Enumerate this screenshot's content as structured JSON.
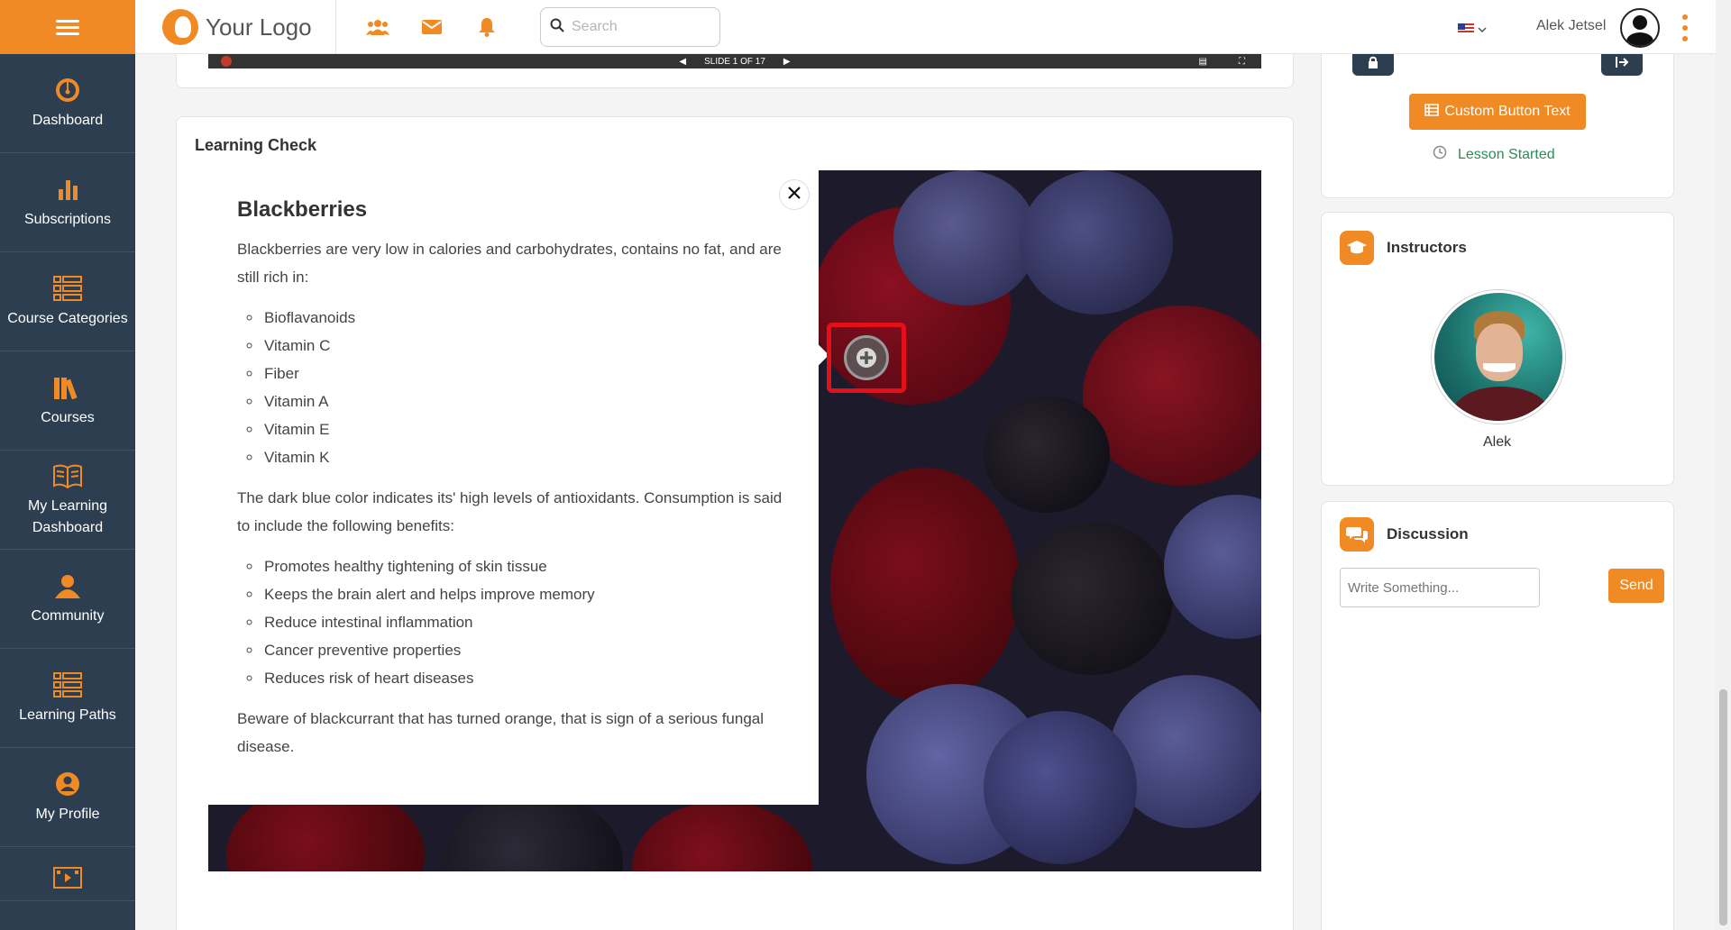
{
  "header": {
    "logo_text": "Your Logo",
    "search_placeholder": "Search",
    "user_name": "Alek Jetsel",
    "language_flag": "us-flag-icon"
  },
  "sidebar": {
    "items": [
      {
        "label": "Dashboard",
        "icon": "gauge-icon"
      },
      {
        "label": "Subscriptions",
        "icon": "bar-chart-icon"
      },
      {
        "label": "Course Categories",
        "icon": "list-icon"
      },
      {
        "label": "Courses",
        "icon": "books-icon"
      },
      {
        "label": "My Learning Dashboard",
        "icon": "open-book-icon"
      },
      {
        "label": "Community",
        "icon": "community-icon"
      },
      {
        "label": "Learning Paths",
        "icon": "list-icon"
      },
      {
        "label": "My Profile",
        "icon": "user-circle-icon"
      }
    ]
  },
  "slide_player": {
    "slide_indicator": "SLIDE 1 OF 17"
  },
  "learning_check": {
    "title": "Learning Check",
    "popup": {
      "heading": "Blackberries",
      "intro": "Blackberries are very low in calories and carbohydrates, contains no fat, and are still rich in:",
      "nutrients": [
        "Bioflavanoids",
        "Vitamin C",
        "Fiber",
        "Vitamin A",
        "Vitamin E",
        "Vitamin K"
      ],
      "benefits_intro": "The dark blue color indicates its' high levels of antioxidants. Consumption is said to include the following benefits:",
      "benefits": [
        "Promotes healthy tightening of skin tissue",
        "Keeps the brain alert and helps improve memory",
        "Reduce intestinal inflammation",
        "Cancer preventive properties",
        "Reduces risk of heart diseases"
      ],
      "warning": "Beware of blackcurrant that has turned orange, that is sign of a serious fungal disease."
    }
  },
  "lesson_panel": {
    "custom_button_label": "Custom Button Text",
    "lesson_status": "Lesson Started",
    "status_color": "#2e8b57"
  },
  "instructors": {
    "title": "Instructors",
    "items": [
      {
        "name": "Alek"
      }
    ]
  },
  "discussion": {
    "title": "Discussion",
    "input_placeholder": "Write Something...",
    "send_label": "Send"
  },
  "colors": {
    "accent": "#f08a24",
    "sidebar_bg": "#2c3e50",
    "highlight": "#e3101a"
  }
}
